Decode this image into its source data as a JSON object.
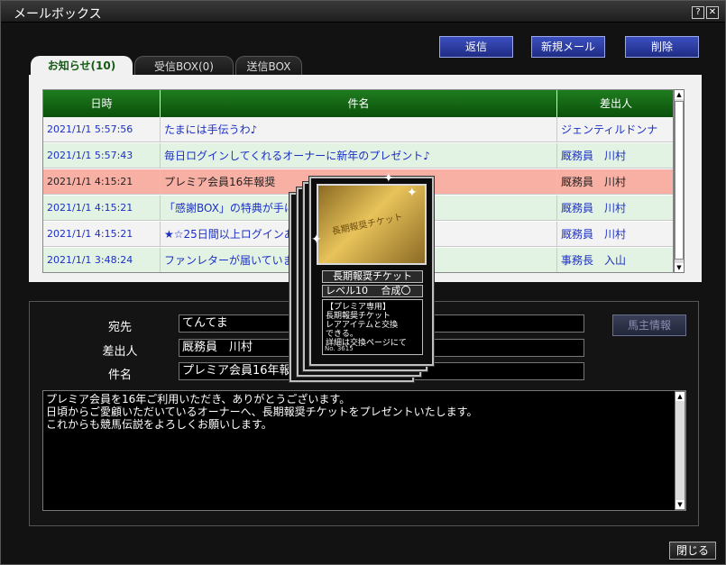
{
  "window": {
    "title": "メールボックス",
    "help": "?",
    "close": "✕"
  },
  "toolbar": {
    "reply": "返信",
    "new_mail": "新規メール",
    "delete": "削除"
  },
  "tabs": [
    {
      "label": "お知らせ(10)"
    },
    {
      "label": "受信BOX(0)"
    },
    {
      "label": "送信BOX"
    }
  ],
  "table": {
    "headers": [
      "日時",
      "件名",
      "差出人"
    ],
    "rows": [
      {
        "date": "2021/1/1 5:57:56",
        "subject": "たまには手伝うわ♪",
        "from": "ジェンティルドンナ"
      },
      {
        "date": "2021/1/1 5:57:43",
        "subject": "毎日ログインしてくれるオーナーに新年のプレゼント♪",
        "from": "厩務員　川村"
      },
      {
        "date": "2021/1/1 4:15:21",
        "subject": "プレミア会員16年報奨",
        "from": "厩務員　川村"
      },
      {
        "date": "2021/1/1 4:15:21",
        "subject": "「感謝BOX」の特典が手に入",
        "from": "厩務員　川村"
      },
      {
        "date": "2021/1/1 4:15:21",
        "subject": "★☆25日間以上ログインあり",
        "from": "厩務員　川村"
      },
      {
        "date": "2021/1/1 3:48:24",
        "subject": "ファンレターが届いています。",
        "from": "事務長　入山"
      }
    ]
  },
  "detail": {
    "to_label": "宛先",
    "to_value": "てんてま",
    "from_label": "差出人",
    "from_value": "厩務員　川村",
    "subject_label": "件名",
    "subject_value": "プレミア会員16年報奨",
    "owner_button": "馬主情報",
    "body": "プレミア会員を16年ご利用いただき、ありがとうございます。\n日頃からご愛顧いただいているオーナーへ、長期報奨チケットをプレゼントいたします。\nこれからも競馬伝説をよろしくお願いします。"
  },
  "card": {
    "image_text": "長期報奨チケット",
    "name": "長期報奨チケット",
    "level": "レベル10　 合成〇",
    "description": "【プレミア専用】\n長期報奨チケット\nレアアイテムと交換\nできる。\n詳細は交換ページにて",
    "number": "No. 3615"
  },
  "footer": {
    "close": "閉じる"
  },
  "colors": {
    "header_green": "#0b4f0b",
    "row_green": "#e3f3e3",
    "selected_row": "#f8b0a5",
    "link_blue": "#1a2fc8",
    "button_blue": "#1f2c84"
  }
}
